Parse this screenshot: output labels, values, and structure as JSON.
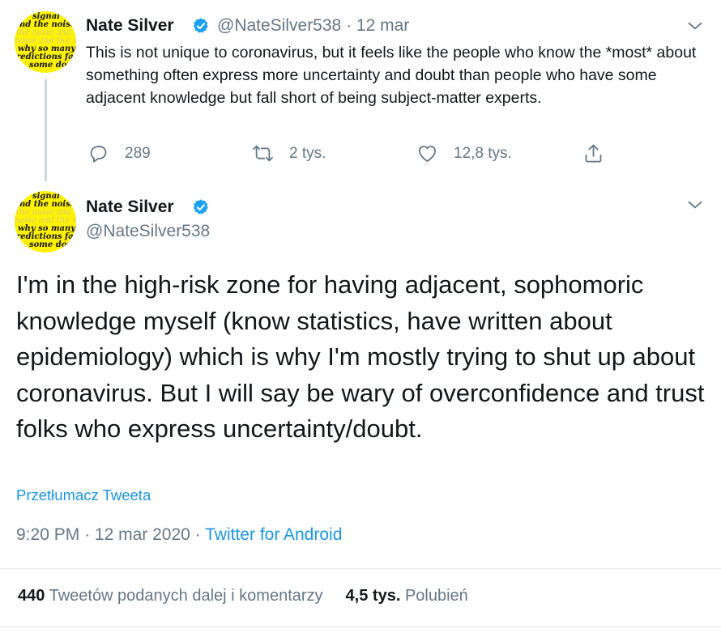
{
  "avatar_lines": [
    "signal",
    "nd the noise",
    "the noise and th",
    "noise and the no",
    "why so many",
    "redictions fail",
    "some don'"
  ],
  "tweet1": {
    "name": "Nate Silver",
    "handle": "@NateSilver538",
    "separator": "·",
    "date": "12 mar",
    "text": "This is not unique to coronavirus, but it feels like the people who know the *most* about something often express more uncertainty and doubt than people who have some adjacent knowledge but fall short of  being subject-matter experts.",
    "replies": "289",
    "retweets": "2 tys.",
    "likes": "12,8 tys."
  },
  "tweet2": {
    "name": "Nate Silver",
    "handle": "@NateSilver538",
    "text": "I'm in the high-risk zone for having adjacent, sophomoric knowledge myself (know statistics, have written about epidemiology) which is why I'm mostly trying to shut up about coronavirus. But I will say be wary of overconfidence and trust folks who express uncertainty/doubt.",
    "translate": "Przetłumacz Tweeta",
    "time": "9:20 PM",
    "meta_sep": "·",
    "date": "12 mar 2020",
    "meta_sep2": "·",
    "source": "Twitter for Android",
    "retweet_count": "440",
    "retweet_label": "Tweetów podanych dalej i komentarzy",
    "like_count": "4,5 tys.",
    "like_label": "Polubień"
  },
  "colors": {
    "accent": "#1da1f2",
    "link": "#1b95e0",
    "secondary_text": "#657786",
    "avatar_bg": "#fff200"
  },
  "icons": [
    "verified-badge-icon",
    "chevron-down-icon",
    "reply-icon",
    "retweet-icon",
    "like-icon",
    "share-icon"
  ]
}
